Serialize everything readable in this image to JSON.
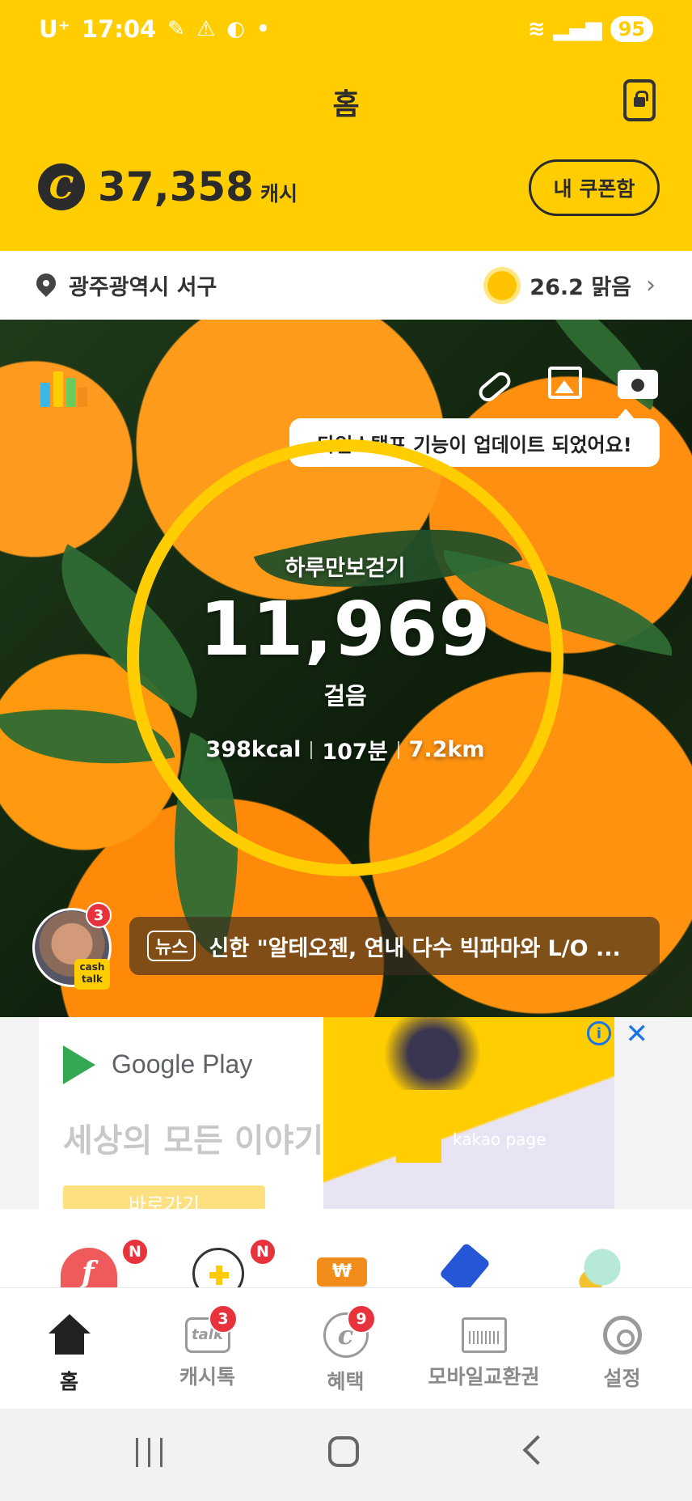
{
  "status_bar": {
    "carrier": "U⁺",
    "time": "17:04",
    "battery": "95"
  },
  "header": {
    "title": "홈",
    "cash_amount": "37,358",
    "cash_unit": "캐시",
    "coupon_button": "내 쿠폰함"
  },
  "location_bar": {
    "location": "광주광역시 서구",
    "weather": "26.2 맑음"
  },
  "hero": {
    "tooltip": "타임스탬프 기능이 업데이트 되었어요!",
    "steps_label": "하루만보걷기",
    "steps": "11,969",
    "steps_unit": "걸음",
    "kcal": "398kcal",
    "minutes": "107분",
    "distance": "7.2km",
    "cashtalk_badge_count": "3",
    "cashtalk_label": "cash talk",
    "news_tag": "뉴스",
    "news_headline": "신한 \"알테오젠, 연내 다수 빅파마와 L/O ..."
  },
  "ad": {
    "brand": "Google Play",
    "headline": "세상의 모든 이야기",
    "cta": "바로가기",
    "publisher": "kakao page",
    "info_icon": "info-icon",
    "close_icon": "close-icon"
  },
  "shortcuts": {
    "items": [
      {
        "icon": "heart-f-icon",
        "badge": "N"
      },
      {
        "icon": "plus-help-icon",
        "badge": "N"
      },
      {
        "icon": "won-icon",
        "badge": ""
      },
      {
        "icon": "bottle-icon",
        "badge": ""
      },
      {
        "icon": "character-icon",
        "badge": ""
      }
    ]
  },
  "bottom_nav": {
    "items": [
      {
        "label": "홈",
        "icon": "home-icon",
        "badge": ""
      },
      {
        "label": "캐시톡",
        "icon": "talk-icon",
        "badge": "3"
      },
      {
        "label": "혜택",
        "icon": "benefit-icon",
        "badge": "9"
      },
      {
        "label": "모바일교환권",
        "icon": "voucher-icon",
        "badge": ""
      },
      {
        "label": "설정",
        "icon": "gear-icon",
        "badge": ""
      }
    ]
  },
  "colors": {
    "brand_yellow": "#FFCD00",
    "badge_red": "#E8333C"
  }
}
